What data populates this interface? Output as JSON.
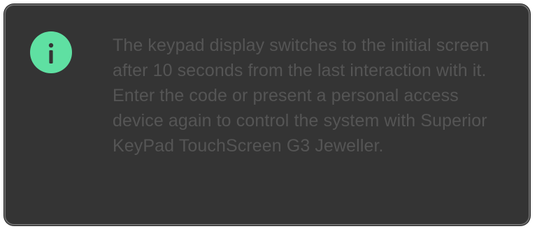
{
  "note": {
    "icon": "info-icon",
    "icon_color": "#5fe0a2",
    "background_color": "#343434",
    "text_color": "#555555",
    "text": "The keypad display switches to the initial screen after 10 seconds from the last interaction with it. Enter the code or present a personal access device again to control the system with Superior KeyPad TouchScreen G3 Jeweller."
  }
}
